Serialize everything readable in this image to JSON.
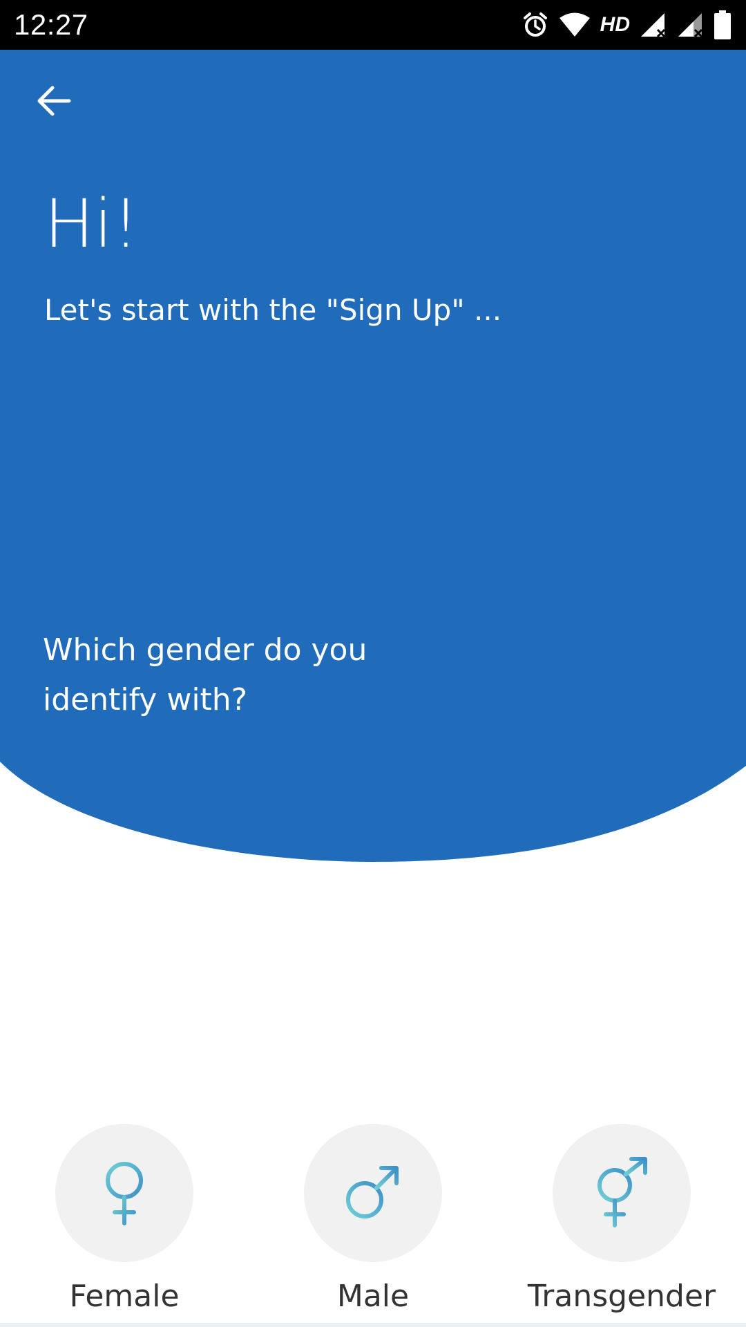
{
  "status_bar": {
    "time": "12:27",
    "hd_label": "HD",
    "icons": [
      "alarm-icon",
      "wifi-icon",
      "signal-icon",
      "signal-icon",
      "battery-icon"
    ]
  },
  "header": {
    "back_icon": "arrow-left-icon",
    "title": "Hi!",
    "subtitle": "Let's start with the \"Sign Up\" ...",
    "question_line1": "Which gender do you",
    "question_line2": "identify with?"
  },
  "gender_options": [
    {
      "label": "Female",
      "icon": "female-symbol-icon"
    },
    {
      "label": "Male",
      "icon": "male-symbol-icon"
    },
    {
      "label": "Transgender",
      "icon": "transgender-symbol-icon"
    }
  ],
  "colors": {
    "primary_blue": "#206CBB",
    "icon_gradient_start": "#6FCFD6",
    "icon_gradient_end": "#3E8FC6",
    "circle_bg": "#F1F1F1"
  }
}
